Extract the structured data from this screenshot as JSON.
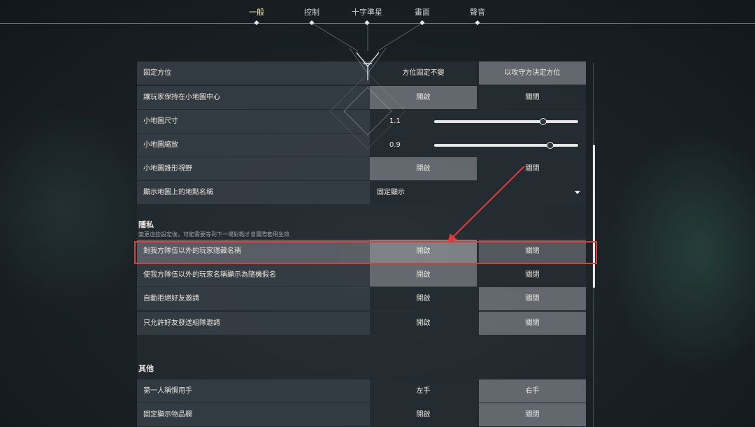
{
  "nav": {
    "tabs": [
      {
        "label": "一般",
        "active": true
      },
      {
        "label": "控制",
        "active": false
      },
      {
        "label": "十字準星",
        "active": false
      },
      {
        "label": "畫面",
        "active": false
      },
      {
        "label": "聲音",
        "active": false
      }
    ]
  },
  "minimap": {
    "fixed_orientation": {
      "label": "固定方位",
      "options": [
        "方位固定不變",
        "以攻守方決定方位"
      ],
      "selected": 1
    },
    "keep_player_centered": {
      "label": "讓玩家保持在小地圖中心",
      "options": [
        "開啟",
        "關閉"
      ],
      "selected": 0
    },
    "size": {
      "label": "小地圖尺寸",
      "value": "1.1",
      "fraction": 0.75
    },
    "zoom": {
      "label": "小地圖縮放",
      "value": "0.9",
      "fraction": 0.8
    },
    "vision_cones": {
      "label": "小地圖錐形視野",
      "options": [
        "開啟",
        "關閉"
      ],
      "selected": 0
    },
    "region_names": {
      "label": "顯示地圖上的地點名稱",
      "value": "固定顯示"
    }
  },
  "privacy": {
    "title": "隱私",
    "subtitle": "變更這些設定後，可能需要等到下一場對戰才會實際套用生效",
    "hide_names": {
      "label": "對我方隊伍以外的玩家隱藏名稱",
      "options": [
        "開啟",
        "關閉"
      ],
      "selected": 0
    },
    "random_names": {
      "label": "使我方隊伍以外的玩家名稱顯示為隨機假名",
      "options": [
        "開啟",
        "關閉"
      ],
      "selected": 0
    },
    "auto_decline_friend": {
      "label": "自動拒絕好友邀請",
      "options": [
        "開啟",
        "關閉"
      ],
      "selected": 1
    },
    "friends_party_only": {
      "label": "只允許好友發送組隊邀請",
      "options": [
        "開啟",
        "關閉"
      ],
      "selected": 1
    }
  },
  "other": {
    "title": "其他",
    "handedness": {
      "label": "第一人稱慣用手",
      "options": [
        "左手",
        "右手"
      ],
      "selected": 1
    },
    "inventory": {
      "label": "固定顯示物品欄",
      "options": [
        "開啟",
        "關閉"
      ],
      "selected": 1
    }
  },
  "colors": {
    "highlight": "#e23b3b",
    "active_tab": "#f3e7b0",
    "selected_option": "#787e83"
  }
}
